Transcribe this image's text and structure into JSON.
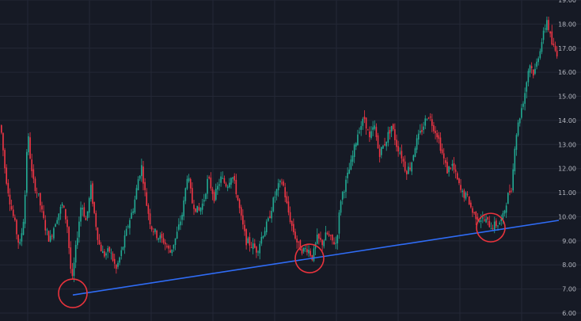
{
  "chart_data": {
    "type": "candlestick",
    "ylim": [
      6.0,
      19.0
    ],
    "y_ticks": [
      "6.00",
      "7.00",
      "8.00",
      "9.00",
      "10.00",
      "11.00",
      "12.00",
      "13.00",
      "14.00",
      "15.00",
      "16.00",
      "17.00",
      "18.00",
      "19.00"
    ],
    "grid": true,
    "candle_count": 330,
    "guide_path_close": [
      [
        0,
        13.8
      ],
      [
        6,
        11.8
      ],
      [
        12,
        10.6
      ],
      [
        18,
        9.7
      ],
      [
        24,
        8.7
      ],
      [
        30,
        10.2
      ],
      [
        34,
        13.6
      ],
      [
        40,
        11.6
      ],
      [
        48,
        10.8
      ],
      [
        56,
        9.6
      ],
      [
        62,
        9.0
      ],
      [
        70,
        9.9
      ],
      [
        78,
        10.5
      ],
      [
        84,
        9.7
      ],
      [
        90,
        7.2
      ],
      [
        96,
        9.0
      ],
      [
        102,
        10.6
      ],
      [
        108,
        9.8
      ],
      [
        114,
        11.2
      ],
      [
        118,
        10.2
      ],
      [
        124,
        8.9
      ],
      [
        130,
        8.4
      ],
      [
        138,
        8.6
      ],
      [
        146,
        7.8
      ],
      [
        154,
        8.7
      ],
      [
        162,
        9.8
      ],
      [
        168,
        10.4
      ],
      [
        174,
        11.6
      ],
      [
        178,
        12.1
      ],
      [
        184,
        10.6
      ],
      [
        190,
        9.6
      ],
      [
        198,
        9.2
      ],
      [
        206,
        9.0
      ],
      [
        214,
        8.5
      ],
      [
        222,
        9.2
      ],
      [
        230,
        10.2
      ],
      [
        236,
        11.8
      ],
      [
        242,
        10.6
      ],
      [
        250,
        10.2
      ],
      [
        256,
        10.6
      ],
      [
        262,
        11.6
      ],
      [
        270,
        10.8
      ],
      [
        278,
        11.6
      ],
      [
        286,
        11.3
      ],
      [
        292,
        11.8
      ],
      [
        298,
        11.0
      ],
      [
        304,
        9.9
      ],
      [
        310,
        9.0
      ],
      [
        318,
        8.8
      ],
      [
        324,
        8.6
      ],
      [
        330,
        9.2
      ],
      [
        338,
        9.8
      ],
      [
        344,
        10.6
      ],
      [
        350,
        11.2
      ],
      [
        356,
        11.5
      ],
      [
        362,
        10.4
      ],
      [
        368,
        9.6
      ],
      [
        376,
        8.8
      ],
      [
        382,
        8.6
      ],
      [
        388,
        8.7
      ],
      [
        394,
        8.3
      ],
      [
        400,
        9.1
      ],
      [
        406,
        8.9
      ],
      [
        412,
        9.3
      ],
      [
        418,
        9.0
      ],
      [
        424,
        8.9
      ],
      [
        430,
        10.8
      ],
      [
        436,
        11.4
      ],
      [
        444,
        12.4
      ],
      [
        452,
        13.6
      ],
      [
        460,
        14.1
      ],
      [
        466,
        13.2
      ],
      [
        472,
        13.8
      ],
      [
        478,
        12.6
      ],
      [
        486,
        13.1
      ],
      [
        494,
        13.8
      ],
      [
        500,
        13.0
      ],
      [
        506,
        12.6
      ],
      [
        512,
        11.9
      ],
      [
        518,
        12.1
      ],
      [
        524,
        13.0
      ],
      [
        532,
        13.6
      ],
      [
        540,
        14.3
      ],
      [
        546,
        13.8
      ],
      [
        552,
        13.4
      ],
      [
        558,
        12.6
      ],
      [
        564,
        11.9
      ],
      [
        570,
        12.2
      ],
      [
        576,
        11.6
      ],
      [
        582,
        11.0
      ],
      [
        590,
        10.8
      ],
      [
        596,
        10.2
      ],
      [
        602,
        10.0
      ],
      [
        608,
        9.9
      ],
      [
        614,
        9.8
      ],
      [
        620,
        9.6
      ],
      [
        628,
        9.7
      ],
      [
        634,
        9.9
      ],
      [
        640,
        10.8
      ],
      [
        646,
        11.3
      ],
      [
        650,
        13.2
      ],
      [
        656,
        14.2
      ],
      [
        662,
        15.1
      ],
      [
        668,
        16.4
      ],
      [
        674,
        15.9
      ],
      [
        680,
        16.8
      ],
      [
        686,
        17.6
      ],
      [
        690,
        18.2
      ],
      [
        696,
        17.2
      ],
      [
        702,
        16.8
      ]
    ],
    "trendline": {
      "from": [
        92,
        6.75
      ],
      "to": [
        706,
        9.85
      ]
    },
    "touch_points": [
      {
        "label": "low-1",
        "x": 92,
        "y": 6.82
      },
      {
        "label": "low-2",
        "x": 391,
        "y": 8.27
      },
      {
        "label": "low-3",
        "x": 620,
        "y": 9.55
      }
    ],
    "colors": {
      "background": "#161a25",
      "grid": "#242836",
      "up": "#22ab94",
      "down": "#f23645",
      "trendline": "#2f6cf6",
      "circle": "#e8333c"
    }
  }
}
